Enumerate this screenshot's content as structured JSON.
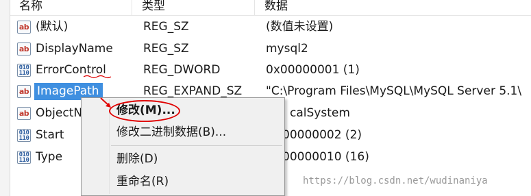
{
  "columns": {
    "name": "名称",
    "type": "类型",
    "data": "数据"
  },
  "rows": [
    {
      "icon": "string-value-icon",
      "badge": "ab",
      "name": "(默认)",
      "type": "REG_SZ",
      "data": "(数值未设置)"
    },
    {
      "icon": "string-value-icon",
      "badge": "ab",
      "name": "DisplayName",
      "type": "REG_SZ",
      "data": "mysql2"
    },
    {
      "icon": "binary-value-icon",
      "badge": "010\n110",
      "name": "ErrorControl",
      "type": "REG_DWORD",
      "data": "0x00000001 (1)"
    },
    {
      "icon": "string-value-icon",
      "badge": "ab",
      "name": "ImagePath",
      "type": "REG_EXPAND_SZ",
      "data": "\"C:\\Program Files\\MySQL\\MySQL Server 5.1\\"
    },
    {
      "icon": "string-value-icon",
      "badge": "ab",
      "name": "ObjectN",
      "type": "",
      "data": "calSystem"
    },
    {
      "icon": "binary-value-icon",
      "badge": "010\n110",
      "name": "Start",
      "type": "",
      "data": "00000002 (2)"
    },
    {
      "icon": "binary-value-icon",
      "badge": "010\n110",
      "name": "Type",
      "type": "",
      "data": "00000010 (16)"
    }
  ],
  "context_menu": {
    "modify": "修改(M)...",
    "modify_binary": "修改二进制数据(B)...",
    "delete": "删除(D)",
    "rename": "重命名(R)"
  },
  "watermark": "https://blog.csdn.net/wudinaniya",
  "colors": {
    "selection": "#3f8fe0",
    "annotation": "#e00000",
    "menu_bg": "#f0f0f0"
  }
}
